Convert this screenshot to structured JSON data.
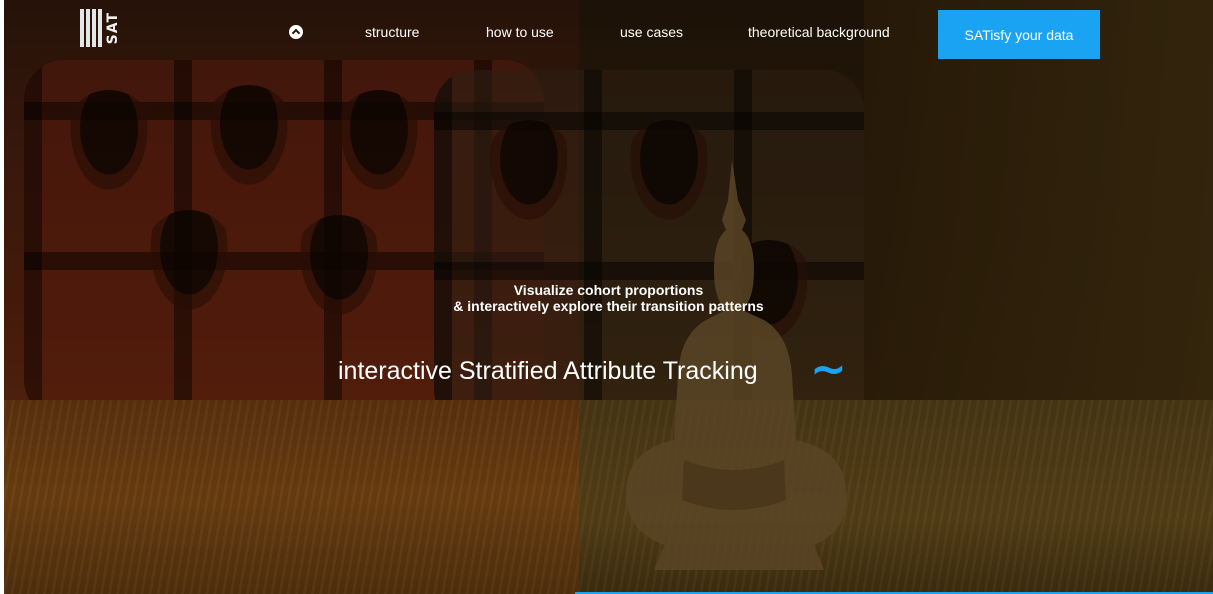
{
  "nav": {
    "logo_text": "SAT",
    "links": [
      "structure",
      "how to use",
      "use cases",
      "theoretical background"
    ],
    "cta_label": "SATisfy your data"
  },
  "hero": {
    "tagline_line1": "Visualize cohort proportions",
    "tagline_line2": "& interactively explore their transition patterns",
    "headline": "interactive Stratified Attribute Tracking",
    "tilde": "~"
  },
  "colors": {
    "accent": "#1aa3f3",
    "text": "#ffffff"
  },
  "icons": {
    "scroll_top": "chevron-up-circle-icon",
    "tilde": "tilde-icon"
  }
}
